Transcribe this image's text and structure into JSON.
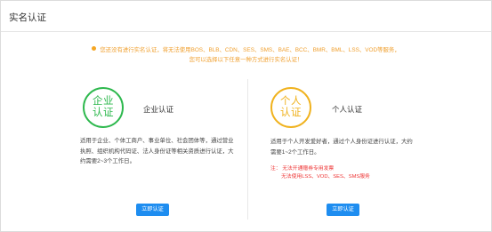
{
  "header": {
    "title": "实名认证"
  },
  "notice": {
    "line1": "您还没有进行实名认证，将无法使用BOS、BLB、CDN、SES、SMS、BAE、BCC、BMR、BML、LSS、VOD等服务，",
    "line2": "您可以选择以下任意一种方式进行实名认证！",
    "color": "#f0a030"
  },
  "enterprise": {
    "badge_line1": "企业",
    "badge_line2": "认证",
    "title": "企业认证",
    "description": "适用于企业、个体工商户、事业单位、社会团体等，通过营业执照、组织机构代码证、法人身份证等相关资质进行认证，大约需要2~3个工作日。",
    "button": "立即认证",
    "accent": "#2db84d"
  },
  "personal": {
    "badge_line1": "个人",
    "badge_line2": "认证",
    "title": "个人认证",
    "description": "适用于个人开发爱好者，通过个人身份证进行认证，大约需要1~2个工作日。",
    "note_line1": "注：  无法开通赠券专用发票",
    "note_line2": "无法使用LSS、VOD、SES、SMS服务",
    "button": "立即认证",
    "accent": "#f0b21e"
  },
  "colors": {
    "button": "#1e8df0",
    "note": "#ee3333"
  }
}
